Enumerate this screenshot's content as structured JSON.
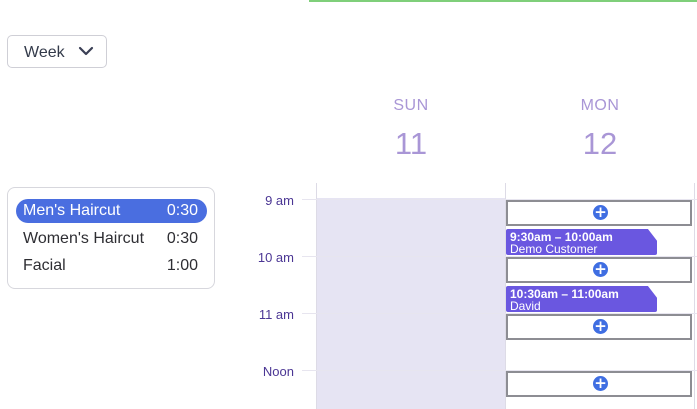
{
  "view_select": {
    "label": "Week",
    "icon": "chevron-down-icon"
  },
  "days": [
    {
      "name": "SUN",
      "number": "11"
    },
    {
      "name": "MON",
      "number": "12"
    }
  ],
  "services": [
    {
      "name": "Men's Haircut",
      "duration": "0:30",
      "selected": true
    },
    {
      "name": "Women's Haircut",
      "duration": "0:30",
      "selected": false
    },
    {
      "name": "Facial",
      "duration": "1:00",
      "selected": false
    }
  ],
  "times": [
    "9 am",
    "10 am",
    "11 am",
    "Noon"
  ],
  "appointments": [
    {
      "time": "9:30am – 10:00am",
      "customer": "Demo Customer"
    },
    {
      "time": "10:30am – 11:00am",
      "customer": "David"
    }
  ],
  "colors": {
    "accent": "#4a6ee0",
    "appointment": "#6a57e0",
    "day_header": "#a996d6",
    "time_label": "#4b3694",
    "unavailable_day": "#e6e4f3"
  }
}
